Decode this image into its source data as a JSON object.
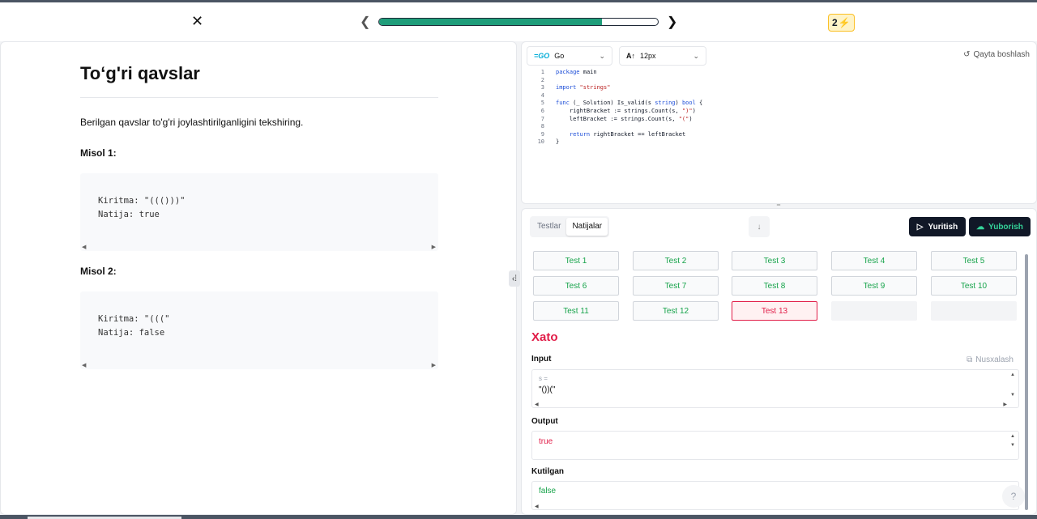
{
  "topbar": {
    "close_icon": "close-icon",
    "prev_icon": "chevron-left-icon",
    "next_icon": "chevron-right-icon",
    "progress_fraction": 0.8,
    "streak_count": "2",
    "streak_icon": "lightning-icon",
    "accent_color": "#1f9d7a"
  },
  "problem": {
    "title": "To‘g'ri qavslar",
    "description": "Berilgan qavslar to'g'ri joylashtirilganligini tekshiring.",
    "examples": [
      {
        "label": "Misol 1:",
        "input_line": "Kiritma: \"((()))\"",
        "output_line": "Natija: true"
      },
      {
        "label": "Misol 2:",
        "input_line": "Kiritma: \"(((\"",
        "output_line": "Natija: false"
      }
    ]
  },
  "editor": {
    "language": "Go",
    "font_size": "12px",
    "reset_label": "Qayta boshlash",
    "code": [
      "package main",
      "",
      "import \"strings\"",
      "",
      "func (_ Solution) Is_valid(s string) bool {",
      "    rightBracket := strings.Count(s, \")\")",
      "    leftBracket := strings.Count(s, \"(\")",
      "",
      "    return rightBracket == leftBracket",
      "}"
    ],
    "line_numbers": [
      "1",
      "2",
      "3",
      "4",
      "5",
      "6",
      "7",
      "8",
      "9",
      "10"
    ]
  },
  "results": {
    "tabs": [
      {
        "label": "Testlar"
      },
      {
        "label": "Natijalar"
      }
    ],
    "run_label": "Yuritish",
    "submit_label": "Yuborish",
    "tests": [
      {
        "label": "Test 1",
        "status": "pass"
      },
      {
        "label": "Test 2",
        "status": "pass"
      },
      {
        "label": "Test 3",
        "status": "pass"
      },
      {
        "label": "Test 4",
        "status": "pass"
      },
      {
        "label": "Test 5",
        "status": "pass"
      },
      {
        "label": "Test 6",
        "status": "pass"
      },
      {
        "label": "Test 7",
        "status": "pass"
      },
      {
        "label": "Test 8",
        "status": "pass"
      },
      {
        "label": "Test 9",
        "status": "pass"
      },
      {
        "label": "Test 10",
        "status": "pass"
      },
      {
        "label": "Test 11",
        "status": "pass"
      },
      {
        "label": "Test 12",
        "status": "pass"
      },
      {
        "label": "Test 13",
        "status": "fail"
      }
    ],
    "error_title": "Xato",
    "input_label": "Input",
    "copy_label": "Nusxalash",
    "input_var": "s =",
    "input_value": "\"())(\"",
    "output_label": "Output",
    "output_value": "true",
    "expected_label": "Kutilgan",
    "expected_value": "false",
    "pass_color": "#16a34a",
    "fail_color": "#e11d48"
  },
  "help": {
    "label": "?"
  }
}
